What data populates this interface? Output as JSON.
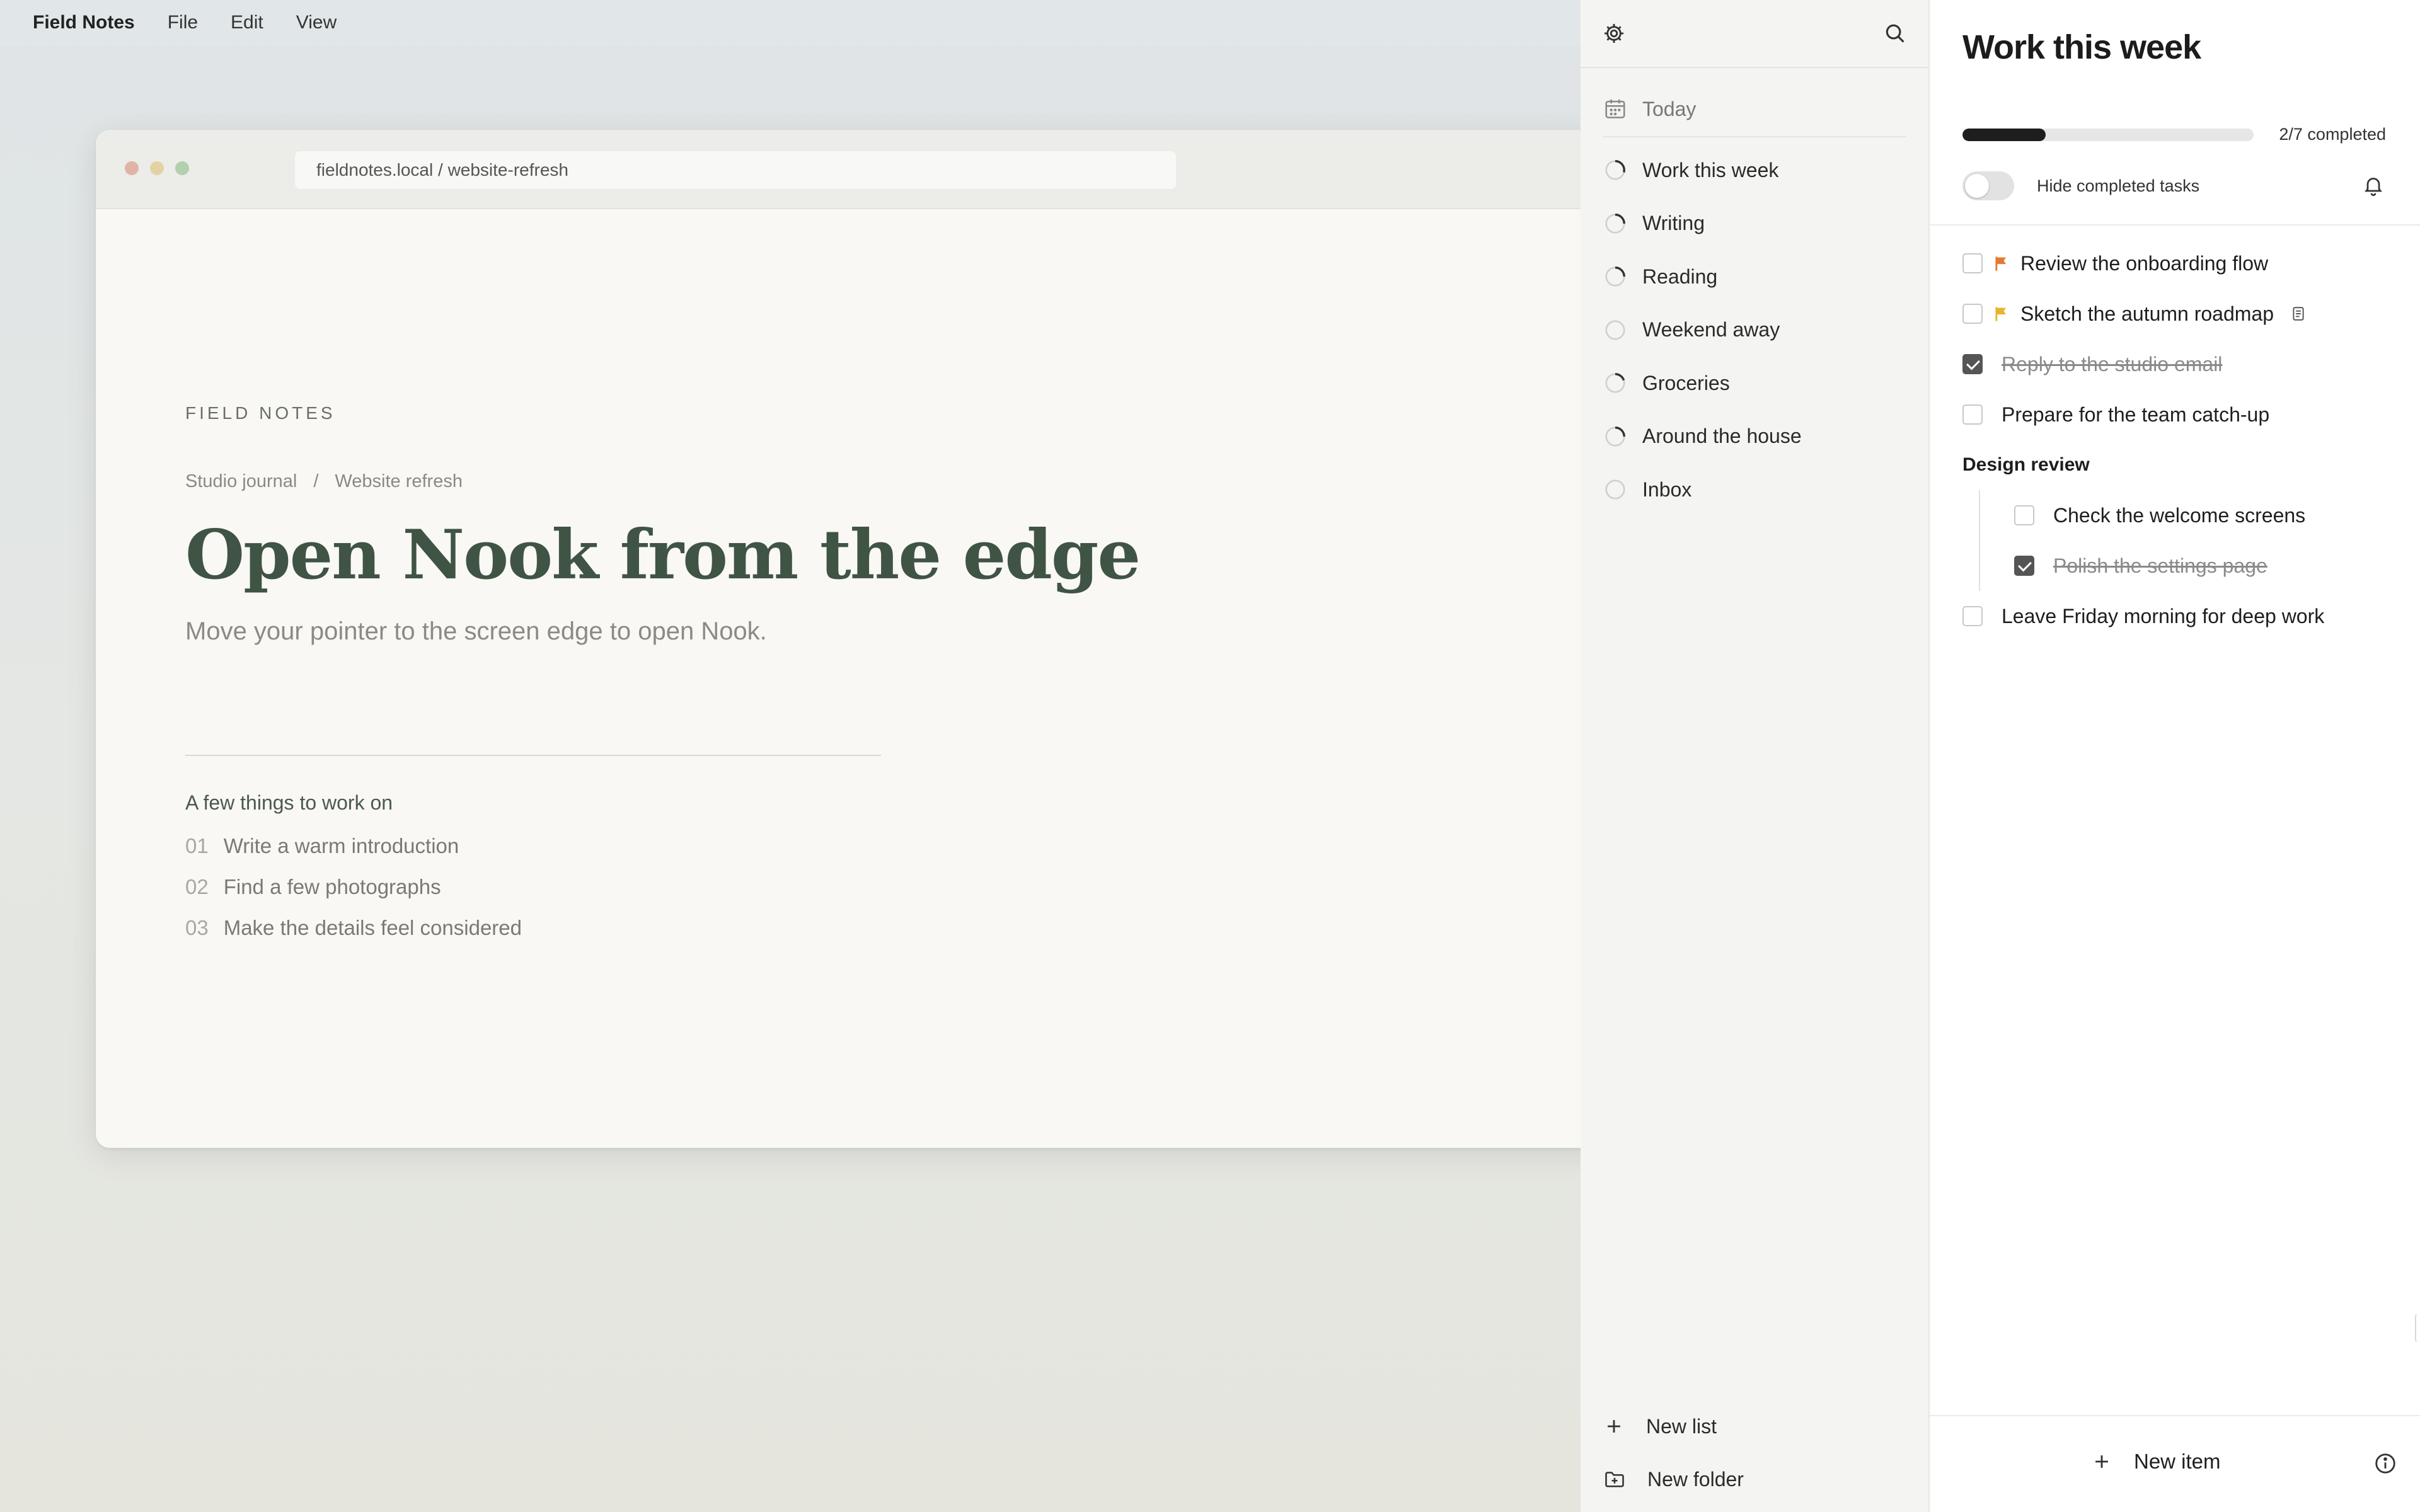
{
  "menubar": {
    "app_name": "Field Notes",
    "items": [
      "File",
      "Edit",
      "View"
    ]
  },
  "browser": {
    "url": "fieldnotes.local / website-refresh",
    "eyebrow": "FIELD NOTES",
    "breadcrumb": [
      "Studio journal",
      "/",
      "Website refresh"
    ],
    "headline": "Open Nook from the edge",
    "subline": "Move your pointer to the screen edge to open Nook.",
    "todo_title": "A few things to work on",
    "todos": [
      {
        "num": "01",
        "text": "Write a warm introduction"
      },
      {
        "num": "02",
        "text": "Find a few photographs"
      },
      {
        "num": "03",
        "text": "Make the details feel considered"
      }
    ]
  },
  "sidebar": {
    "today_label": "Today",
    "lists": [
      {
        "label": "Work this week",
        "progress": 0.29
      },
      {
        "label": "Writing",
        "progress": 0.25
      },
      {
        "label": "Reading",
        "progress": 0.25
      },
      {
        "label": "Weekend away",
        "progress": 0
      },
      {
        "label": "Groceries",
        "progress": 0.2
      },
      {
        "label": "Around the house",
        "progress": 0.25
      },
      {
        "label": "Inbox",
        "progress": 0
      }
    ],
    "new_list_label": "New list",
    "new_folder_label": "New folder",
    "icons": [
      "gear-icon",
      "search-icon",
      "calendar-icon",
      "plus-icon",
      "folder-plus-icon"
    ]
  },
  "panel": {
    "title": "Work this week",
    "progress": 0.2857,
    "completed_text": "2/7 completed",
    "hide_completed_label": "Hide completed tasks",
    "hide_completed_on": false,
    "tasks": [
      {
        "text": "Review the onboarding flow",
        "done": false,
        "flag": "#e8772e"
      },
      {
        "text": "Sketch the autumn roadmap",
        "done": false,
        "flag": "#e8b430",
        "note": true
      },
      {
        "text": "Reply to the studio email",
        "done": true
      },
      {
        "text": "Prepare for the team catch-up",
        "done": false
      }
    ],
    "group": {
      "label": "Design review",
      "tasks": [
        {
          "text": "Check the welcome screens",
          "done": false
        },
        {
          "text": "Polish the settings page",
          "done": true
        }
      ]
    },
    "tail_tasks": [
      {
        "text": "Leave Friday morning for deep work",
        "done": false
      }
    ],
    "new_item_label": "New item",
    "colors": {
      "progress_fill": "#1e1e1e",
      "flag_orange": "#e8772e",
      "flag_yellow": "#e8b430",
      "headline": "#3f5444"
    }
  }
}
